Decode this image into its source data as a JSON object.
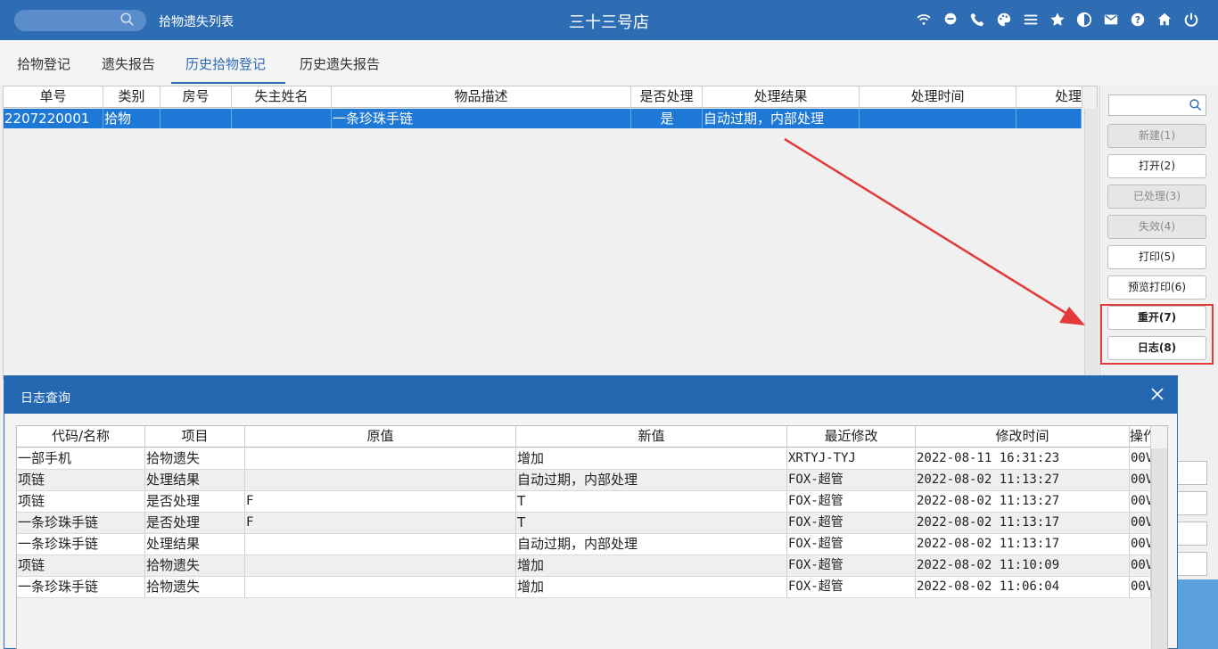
{
  "header": {
    "list_title": "拾物遗失列表",
    "store_name": "三十三号店",
    "icons": [
      "wifi-icon",
      "chat-icon",
      "phone-icon",
      "palette-icon",
      "menu-icon",
      "star-icon",
      "contrast-icon",
      "mail-icon",
      "help-icon",
      "home-icon",
      "power-icon"
    ]
  },
  "tabs": [
    {
      "label": "拾物登记",
      "active": false
    },
    {
      "label": "遗失报告",
      "active": false
    },
    {
      "label": "历史拾物登记",
      "active": true
    },
    {
      "label": "历史遗失报告",
      "active": false
    }
  ],
  "main_table": {
    "columns": [
      "单号",
      "类别",
      "房号",
      "失主姓名",
      "物品描述",
      "是否处理",
      "处理结果",
      "处理时间",
      "处理"
    ],
    "rows": [
      [
        "2207220001",
        "拾物",
        "",
        "",
        "一条珍珠手链",
        "是",
        "自动过期，内部处理",
        "",
        ""
      ]
    ]
  },
  "side_panel": {
    "buttons": [
      {
        "label": "新建(1)",
        "enabled": false
      },
      {
        "label": "打开(2)",
        "enabled": true
      },
      {
        "label": "已处理(3)",
        "enabled": false
      },
      {
        "label": "失效(4)",
        "enabled": false
      },
      {
        "label": "打印(5)",
        "enabled": true
      },
      {
        "label": "预览打印(6)",
        "enabled": true
      },
      {
        "label": "重开(7)",
        "enabled": true
      },
      {
        "label": "日志(8)",
        "enabled": true
      }
    ]
  },
  "log_dialog": {
    "title": "日志查询",
    "columns": [
      "代码/名称",
      "项目",
      "原值",
      "新值",
      "最近修改",
      "修改时间",
      "操作"
    ],
    "rows": [
      [
        "一部手机",
        "拾物遗失",
        "",
        "增加",
        "XRTYJ-TYJ",
        "2022-08-11 16:31:23",
        "00V"
      ],
      [
        "项链",
        "处理结果",
        "",
        "自动过期，内部处理",
        "FOX-超管",
        "2022-08-02 11:13:27",
        "00V"
      ],
      [
        "项链",
        "是否处理",
        "F",
        "T",
        "FOX-超管",
        "2022-08-02 11:13:27",
        "00V"
      ],
      [
        "一条珍珠手链",
        "是否处理",
        "F",
        "T",
        "FOX-超管",
        "2022-08-02 11:13:17",
        "00V"
      ],
      [
        "一条珍珠手链",
        "处理结果",
        "",
        "自动过期，内部处理",
        "FOX-超管",
        "2022-08-02 11:13:17",
        "00V"
      ],
      [
        "项链",
        "拾物遗失",
        "",
        "增加",
        "FOX-超管",
        "2022-08-02 11:10:09",
        "00V"
      ],
      [
        "一条珍珠手链",
        "拾物遗失",
        "",
        "增加",
        "FOX-超管",
        "2022-08-02 11:06:04",
        "00V"
      ]
    ]
  },
  "colors": {
    "header_blue": "#2e6db4",
    "selection_blue": "#1e78d6",
    "annotation_red": "#e23a3a"
  }
}
